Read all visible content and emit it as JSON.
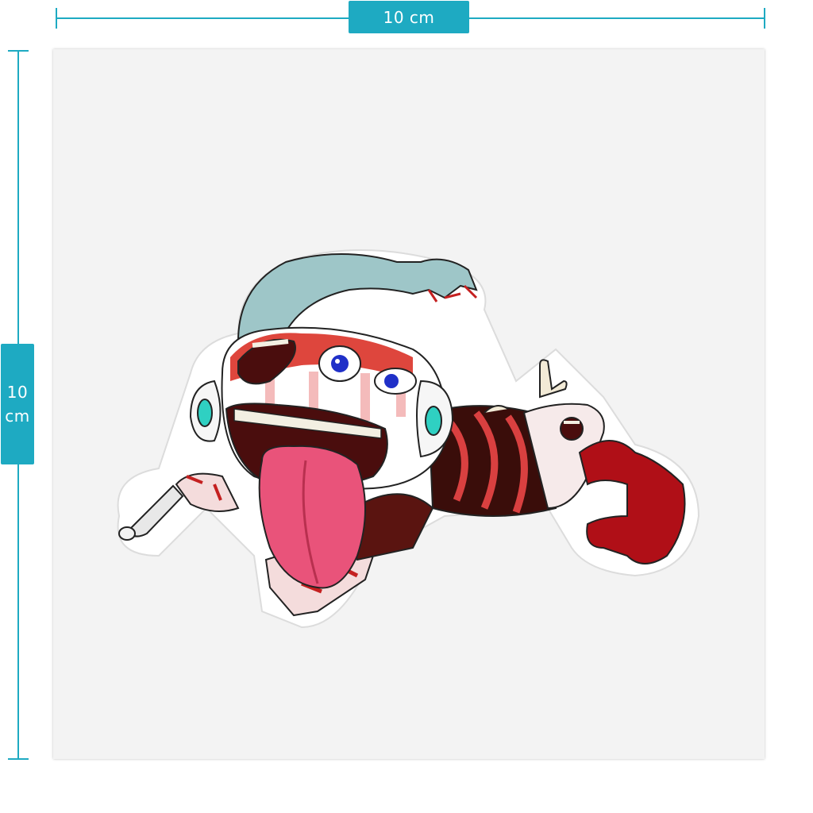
{
  "colors": {
    "accent": "#1eaac2",
    "sheet": "#f3f3f3",
    "sticker_red": "#d8261b",
    "tongue": "#e9537a",
    "eye_teal": "#2fd0c2",
    "arm_grey_teal": "#9ec6c8",
    "hand_red": "#b00f17"
  },
  "dimensions": {
    "width_label": "10 cm",
    "height_label_value": "10",
    "height_label_unit": "cm"
  },
  "sticker": {
    "icon": "creature-sticker-illustration"
  }
}
